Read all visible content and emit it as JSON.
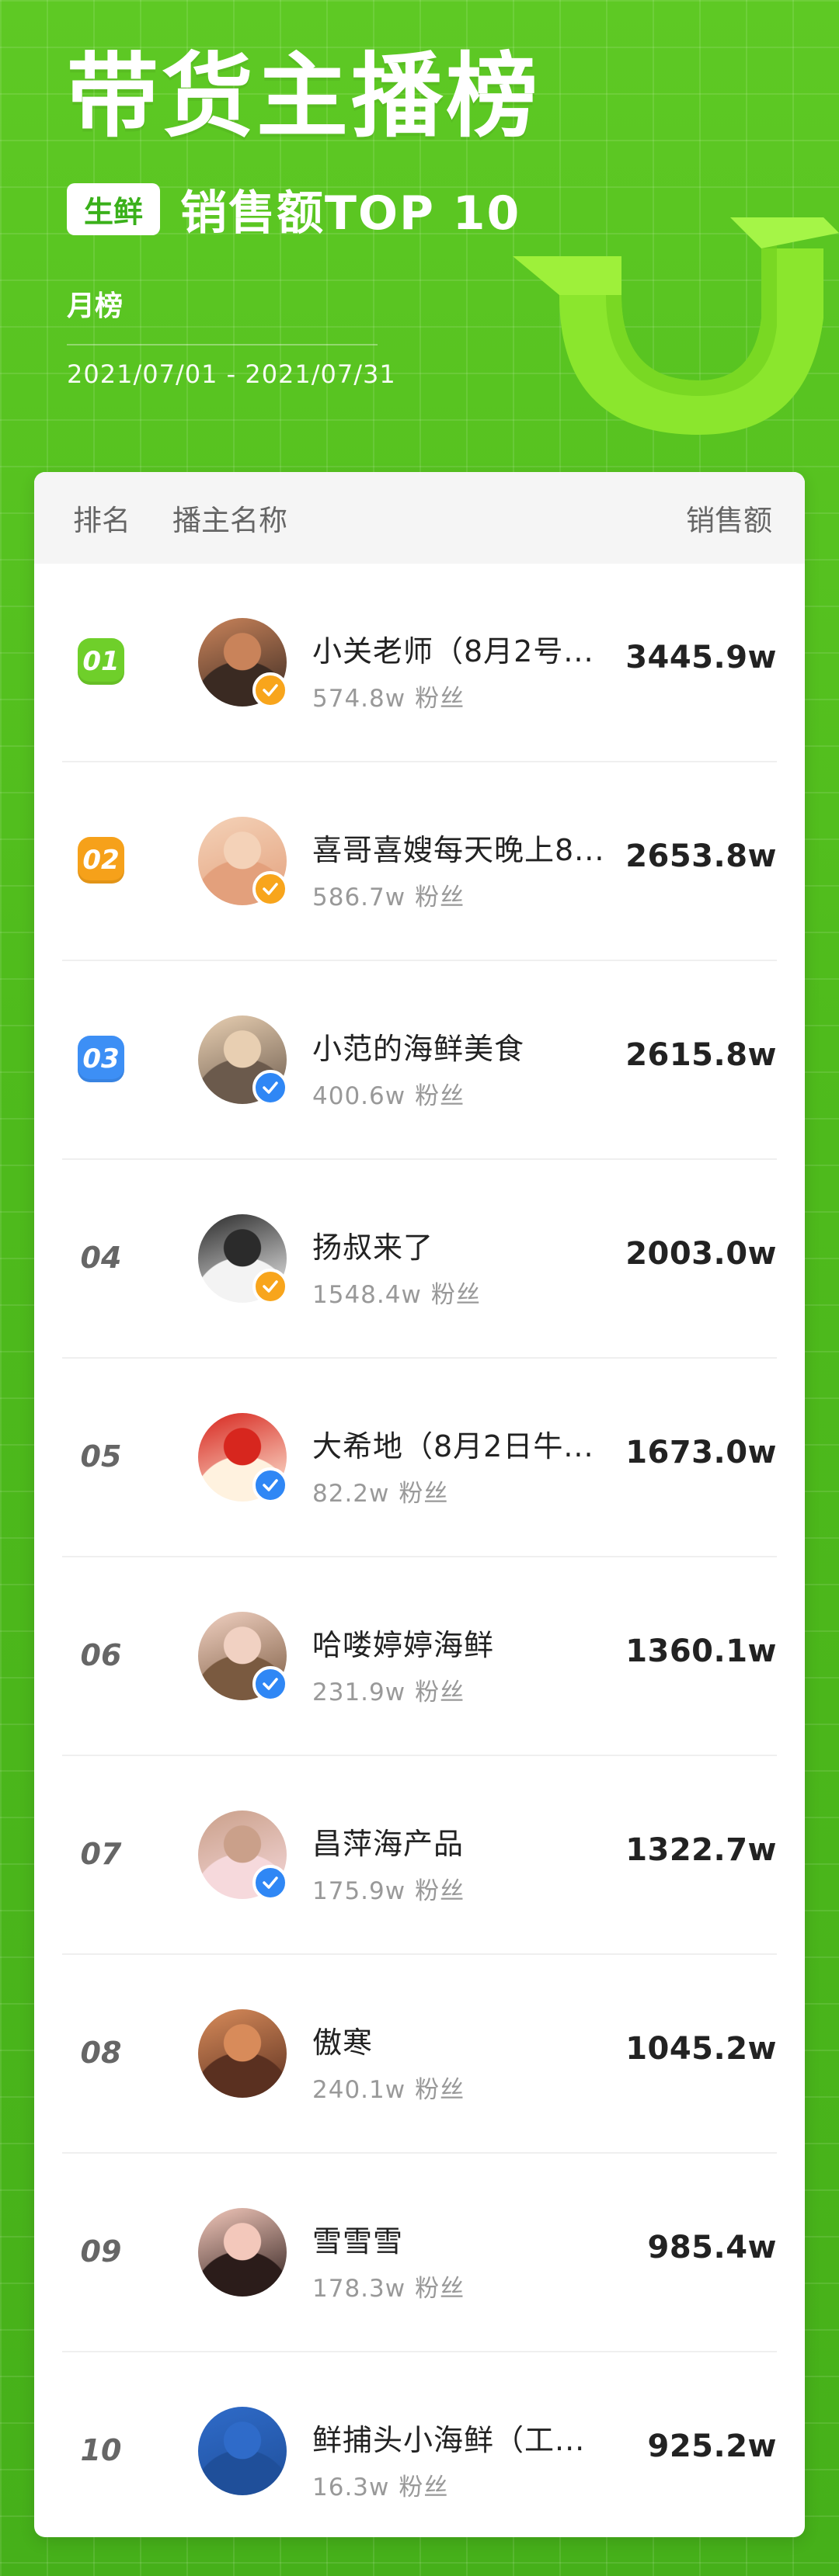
{
  "header": {
    "title": "带货主播榜",
    "tag": "生鲜",
    "subtitle": "销售额TOP 10",
    "period": "月榜",
    "date_range": "2021/07/01 - 2021/07/31"
  },
  "table": {
    "col_rank": "排名",
    "col_name": "播主名称",
    "col_sales": "销售额",
    "fans_unit": "粉丝",
    "rows": [
      {
        "rank": "01",
        "name": "小关老师（8月2号...",
        "fans": "574.8w",
        "sales": "3445.9w",
        "verify": "gold"
      },
      {
        "rank": "02",
        "name": "喜哥喜嫂每天晚上8...",
        "fans": "586.7w",
        "sales": "2653.8w",
        "verify": "gold"
      },
      {
        "rank": "03",
        "name": "小范的海鲜美食",
        "fans": "400.6w",
        "sales": "2615.8w",
        "verify": "blue"
      },
      {
        "rank": "04",
        "name": "扬叔来了",
        "fans": "1548.4w",
        "sales": "2003.0w",
        "verify": "gold"
      },
      {
        "rank": "05",
        "name": "大希地（8月2日牛...",
        "fans": "82.2w",
        "sales": "1673.0w",
        "verify": "blue"
      },
      {
        "rank": "06",
        "name": "哈喽婷婷海鲜",
        "fans": "231.9w",
        "sales": "1360.1w",
        "verify": "blue"
      },
      {
        "rank": "07",
        "name": "昌萍海产品",
        "fans": "175.9w",
        "sales": "1322.7w",
        "verify": "blue"
      },
      {
        "rank": "08",
        "name": "傲寒",
        "fans": "240.1w",
        "sales": "1045.2w",
        "verify": "none"
      },
      {
        "rank": "09",
        "name": "雪雪雪",
        "fans": "178.3w",
        "sales": "985.4w",
        "verify": "none"
      },
      {
        "rank": "10",
        "name": "鲜捕头小海鲜（工...",
        "fans": "16.3w",
        "sales": "925.2w",
        "verify": "none"
      }
    ]
  },
  "colors": {
    "bg_green": "#4db81d",
    "rank1": "#6fcf2a",
    "rank2": "#f6a11a",
    "rank3": "#3d8ff5",
    "verify_gold": "#f8a51c",
    "verify_blue": "#2f87f5"
  },
  "icons": {
    "verify": "checkmark-badge-icon",
    "decoration": "3d-letter-decoration"
  }
}
